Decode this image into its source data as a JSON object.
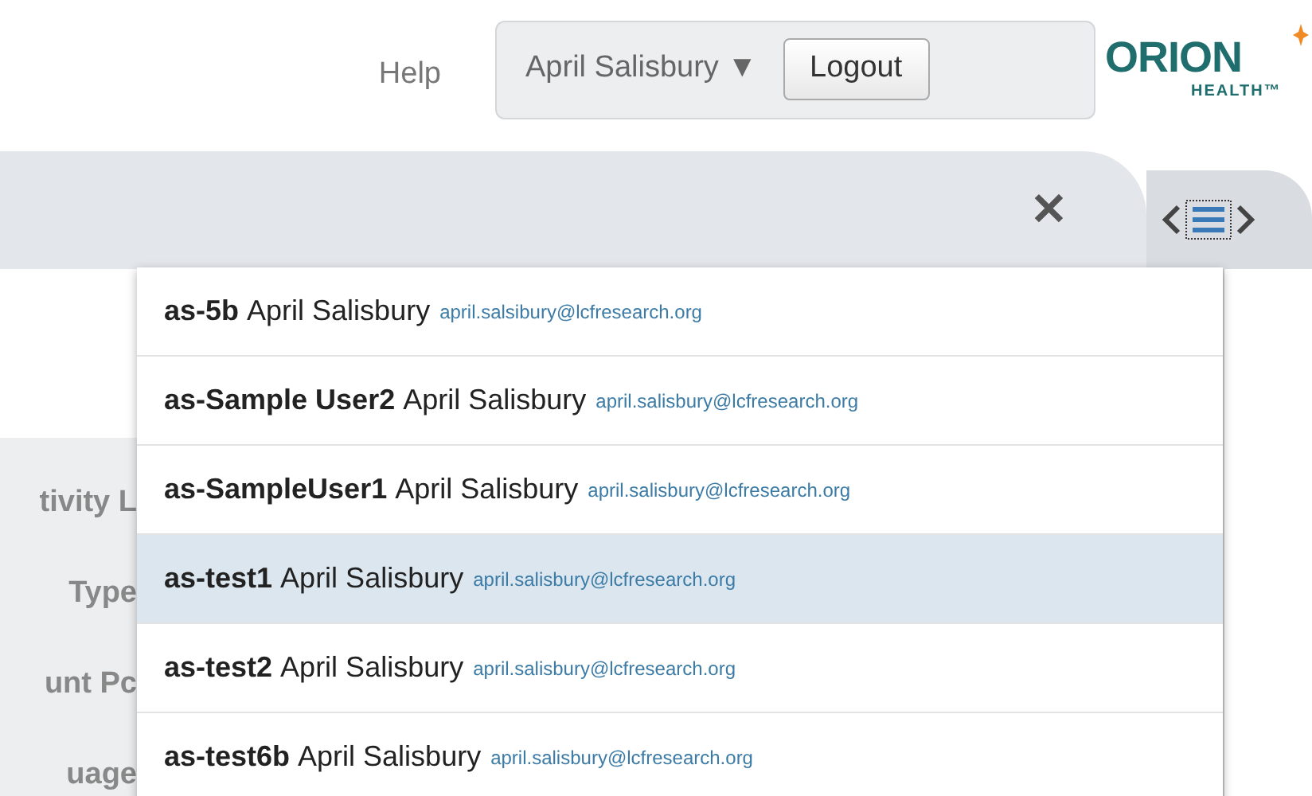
{
  "header": {
    "help": "Help",
    "user_menu": {
      "label": "April Salisbury",
      "caret": "▼"
    },
    "logout": "Logout",
    "logo": {
      "name": "ORION",
      "tagline": "HEALTH™"
    }
  },
  "tab_bar": {
    "close": "✕"
  },
  "form_labels": [
    "tivity L",
    "Type",
    "unt Pc",
    "uage"
  ],
  "dropdown": [
    {
      "id": "as-5b",
      "name": "April Salisbury",
      "email": "april.salsibury@lcfresearch.org",
      "selected": false
    },
    {
      "id": "as-Sample User2",
      "name": "April Salisbury",
      "email": "april.salisbury@lcfresearch.org",
      "selected": false
    },
    {
      "id": "as-SampleUser1",
      "name": "April Salisbury",
      "email": "april.salisbury@lcfresearch.org",
      "selected": false
    },
    {
      "id": "as-test1",
      "name": "April Salisbury",
      "email": "april.salisbury@lcfresearch.org",
      "selected": true
    },
    {
      "id": "as-test2",
      "name": "April Salisbury",
      "email": "april.salisbury@lcfresearch.org",
      "selected": false
    },
    {
      "id": "as-test6b",
      "name": "April Salisbury",
      "email": "april.salisbury@lcfresearch.org",
      "selected": false
    }
  ]
}
